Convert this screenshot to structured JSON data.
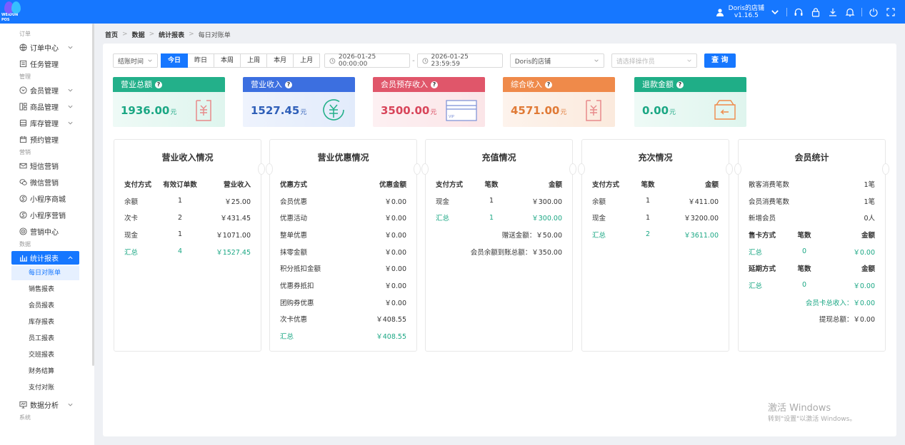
{
  "app": {
    "logo_text": "WEIDUN POS"
  },
  "topbar": {
    "store_name": "Doris的店铺",
    "version": "v1.16.5"
  },
  "colors": {
    "primary": "#1677ff",
    "green": "#1ba784",
    "blue": "#3c6fe0",
    "red": "#e0566a",
    "orange": "#ef8a4a",
    "teal": "#23b08a"
  },
  "sidebar": {
    "sections": {
      "order": "订单",
      "manage": "管理",
      "marketing": "营销",
      "data": "数据",
      "system": "系统"
    },
    "items": {
      "order_center": "订单中心",
      "task_manage": "任务管理",
      "member_manage": "会员管理",
      "goods_manage": "商品管理",
      "stock_manage": "库存管理",
      "reserve_manage": "预约管理",
      "sms": "短信营销",
      "wechat": "微信营销",
      "mini_mall": "小程序商城",
      "mini_market": "小程序营销",
      "market_center": "营销中心",
      "report": "统计报表",
      "analysis": "数据分析"
    },
    "subitems": [
      "每日对账单",
      "销售报表",
      "会员报表",
      "库存报表",
      "员工报表",
      "交班报表",
      "财务结算",
      "支付对账"
    ]
  },
  "breadcrumb": [
    "首页",
    "数据",
    "统计报表",
    "每日对账单"
  ],
  "filters": {
    "time_type": "结账时间",
    "ranges": [
      "今日",
      "昨日",
      "本周",
      "上周",
      "本月",
      "上月"
    ],
    "start": "2026-01-25 00:00:00",
    "end": "2026-01-25 23:59:59",
    "store": "Doris的店铺",
    "operator_placeholder": "请选择操作员",
    "query": "查 询"
  },
  "stats": [
    {
      "title": "营业总额",
      "value": "1936.00",
      "unit": "元"
    },
    {
      "title": "营业收入",
      "value": "1527.45",
      "unit": "元"
    },
    {
      "title": "会员预存收入",
      "value": "3500.00",
      "unit": "元"
    },
    {
      "title": "综合收入",
      "value": "4571.00",
      "unit": "元"
    },
    {
      "title": "退款金额",
      "value": "0.00",
      "unit": "元"
    }
  ],
  "income": {
    "title": "营业收入情况",
    "headers": [
      "支付方式",
      "有效订单数",
      "营业收入"
    ],
    "rows": [
      [
        "余额",
        "1",
        "￥25.00"
      ],
      [
        "次卡",
        "2",
        "￥431.45"
      ],
      [
        "现金",
        "1",
        "￥1071.00"
      ]
    ],
    "total": [
      "汇总",
      "4",
      "￥1527.45"
    ]
  },
  "discount": {
    "title": "营业优惠情况",
    "headers": [
      "优惠方式",
      "优惠金额"
    ],
    "rows": [
      [
        "会员优惠",
        "￥0.00"
      ],
      [
        "优惠活动",
        "￥0.00"
      ],
      [
        "整单优惠",
        "￥0.00"
      ],
      [
        "抹零金额",
        "￥0.00"
      ],
      [
        "积分抵扣金额",
        "￥0.00"
      ],
      [
        "优惠券抵扣",
        "￥0.00"
      ],
      [
        "团购券优惠",
        "￥0.00"
      ],
      [
        "次卡优惠",
        "￥408.55"
      ]
    ],
    "total": [
      "汇总",
      "￥408.55"
    ]
  },
  "recharge": {
    "title": "充值情况",
    "headers": [
      "支付方式",
      "笔数",
      "金额"
    ],
    "rows": [
      [
        "现金",
        "1",
        "￥300.00"
      ]
    ],
    "total": [
      "汇总",
      "1",
      "￥300.00"
    ],
    "gift": "赠送金额：￥50.00",
    "arrival": "会员余额到账总额：￥350.00"
  },
  "times": {
    "title": "充次情况",
    "headers": [
      "支付方式",
      "笔数",
      "金额"
    ],
    "rows": [
      [
        "余额",
        "1",
        "￥411.00"
      ],
      [
        "现金",
        "1",
        "￥3200.00"
      ]
    ],
    "total": [
      "汇总",
      "2",
      "￥3611.00"
    ]
  },
  "member": {
    "title": "会员统计",
    "rows": [
      [
        "散客消费笔数",
        "1笔"
      ],
      [
        "会员消费笔数",
        "1笔"
      ],
      [
        "新增会员",
        "0人"
      ]
    ],
    "card_headers": [
      "售卡方式",
      "笔数",
      "金额"
    ],
    "card_total": [
      "汇总",
      "0",
      "￥0.00"
    ],
    "ext_headers": [
      "延期方式",
      "笔数",
      "金额"
    ],
    "ext_total": [
      "汇总",
      "0",
      "￥0.00"
    ],
    "card_income": "会员卡总收入：￥0.00",
    "withdraw": "提现总额：￥0.00"
  },
  "watermark": {
    "line1": "激活 Windows",
    "line2": "转到\"设置\"以激活 Windows。"
  }
}
